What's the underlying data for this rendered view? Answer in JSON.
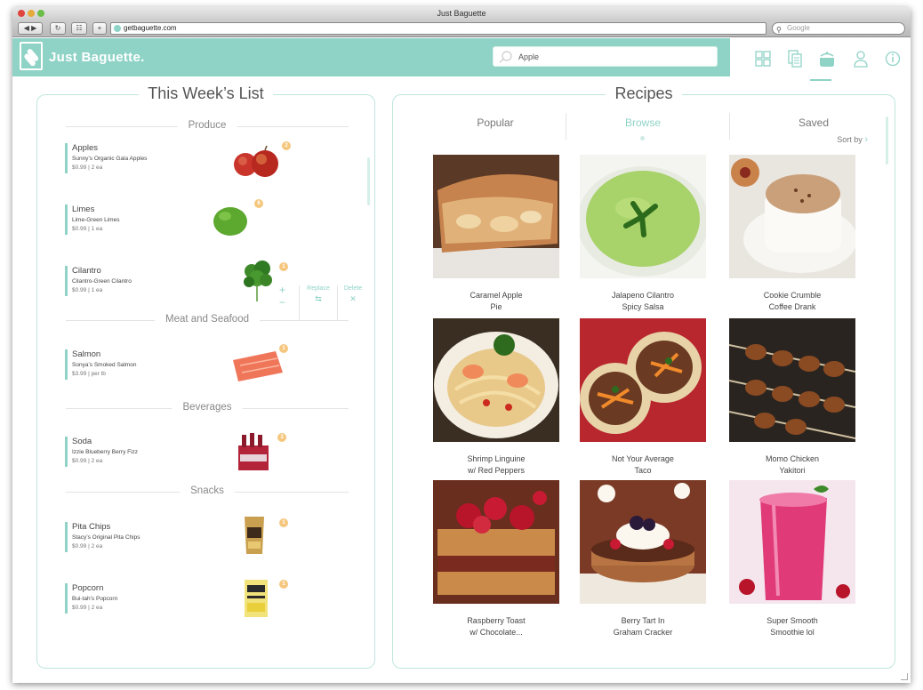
{
  "browser": {
    "window_title": "Just Baguette",
    "url": "getbaguette.com",
    "search_placeholder": "Google"
  },
  "app": {
    "brand": "Just Baguette.",
    "search_value": "Apple",
    "accent_color": "#8fd3c7",
    "header_icons": [
      "grid-icon",
      "recipe-list-icon",
      "pot-icon",
      "user-icon",
      "info-icon"
    ]
  },
  "list": {
    "title": "This Week’s List",
    "sections": [
      {
        "name": "Produce"
      },
      {
        "name": "Meat and Seafood"
      },
      {
        "name": "Beverages"
      },
      {
        "name": "Snacks"
      }
    ],
    "items": [
      {
        "name": "Apples",
        "desc": "Sunny’s Organic Gala Apples",
        "price": "$0.99 | 2 ea",
        "qty": "2"
      },
      {
        "name": "Limes",
        "desc": "Lime-Green Limes",
        "price": "$0.99 | 1 ea",
        "qty": "6"
      },
      {
        "name": "Cilantro",
        "desc": "Cilantro-Green Cilantro",
        "price": "$0.99 | 1 ea",
        "qty": "1"
      },
      {
        "name": "Salmon",
        "desc": "Sonya’s Smoked Salmon",
        "price": "$3.99 | per lb",
        "qty": "1"
      },
      {
        "name": "Soda",
        "desc": "Izzie Blueberry Berry Fizz",
        "price": "$0.99 | 2 ea",
        "qty": "3"
      },
      {
        "name": "Pita Chips",
        "desc": "Stacy’s Original Pita Chips",
        "price": "$0.99 | 2 ea",
        "qty": "1"
      },
      {
        "name": "Popcorn",
        "desc": "Bui-tah’s Popcorn",
        "price": "$0.99 | 2 ea",
        "qty": "1"
      }
    ],
    "actions": {
      "plus": "+",
      "minus": "−",
      "replace": "Replace",
      "delete": "Delete"
    }
  },
  "recipes": {
    "title": "Recipes",
    "tabs": [
      "Popular",
      "Browse",
      "Saved"
    ],
    "active_tab": "Browse",
    "sort_label": "Sort by",
    "cards": [
      {
        "line1": "Caramel Apple",
        "line2": "Pie"
      },
      {
        "line1": "Jalapeno Cilantro",
        "line2": "Spicy Salsa"
      },
      {
        "line1": "Cookie Crumble",
        "line2": "Coffee Drank"
      },
      {
        "line1": "Shrimp Linguine",
        "line2": "w/ Red Peppers"
      },
      {
        "line1": "Not Your Average",
        "line2": "Taco"
      },
      {
        "line1": "Momo Chicken",
        "line2": "Yakitori"
      },
      {
        "line1": "Raspberry Toast",
        "line2": "w/ Chocolate..."
      },
      {
        "line1": "Berry Tart In",
        "line2": "Graham Cracker"
      },
      {
        "line1": "Super Smooth",
        "line2": "Smoothie lol"
      }
    ]
  }
}
